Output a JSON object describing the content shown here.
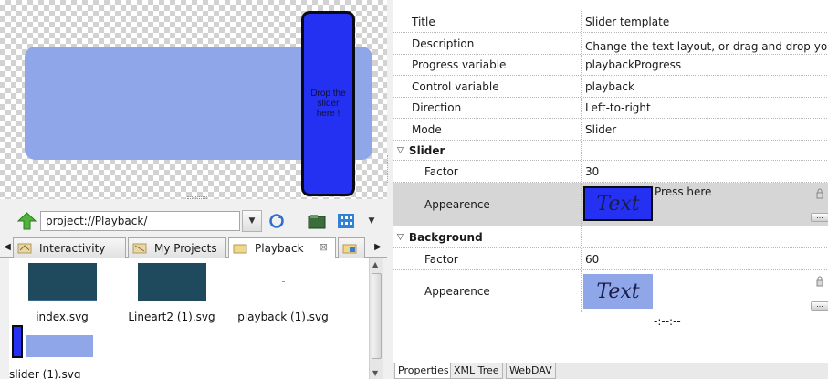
{
  "preview": {
    "drop_text": "Drop the\nslider\nhere !",
    "colors": {
      "track": "#8fa6e8",
      "slider": "#2430f2"
    }
  },
  "pathbar": {
    "path": "project://Playback/",
    "icons": [
      "up-arrow-icon",
      "dropdown-icon",
      "refresh-icon",
      "folder-icon",
      "view-grid-icon",
      "menu-dropdown-icon"
    ]
  },
  "tabs": [
    {
      "label": "Interactivity",
      "icon": "interactivity-icon"
    },
    {
      "label": "My Projects",
      "icon": "projects-icon"
    },
    {
      "label": "Playback",
      "icon": "folder-icon",
      "active": true,
      "close": "⊠"
    }
  ],
  "files": [
    {
      "name": "index.svg"
    },
    {
      "name": "Lineart2 (1).svg"
    },
    {
      "name": "playback (1).svg"
    },
    {
      "name": "slider (1).svg"
    }
  ],
  "properties": {
    "rows": [
      {
        "key": "Title",
        "value": "Slider template"
      },
      {
        "key": "Description",
        "value": "Change the text layout, or drag and drop your …"
      },
      {
        "key": "Progress variable",
        "value": "playbackProgress"
      },
      {
        "key": "Control variable",
        "value": "playback"
      },
      {
        "key": "Direction",
        "value": "Left-to-right"
      },
      {
        "key": "Mode",
        "value": "Slider"
      }
    ],
    "slider_group": {
      "label": "Slider",
      "factor_key": "Factor",
      "factor_value": "30",
      "appearance_key": "Appearence",
      "preview_text": "Text",
      "press_text": "Press here",
      "dots": "..."
    },
    "background_group": {
      "label": "Background",
      "factor_key": "Factor",
      "factor_value": "60",
      "appearance_key": "Appearence",
      "preview_text": "Text",
      "time_text": "-:--:--",
      "dots": "..."
    }
  },
  "bottom_tabs": [
    {
      "label": "Properties",
      "active": true
    },
    {
      "label": "XML Tree"
    },
    {
      "label": "WebDAV"
    }
  ]
}
